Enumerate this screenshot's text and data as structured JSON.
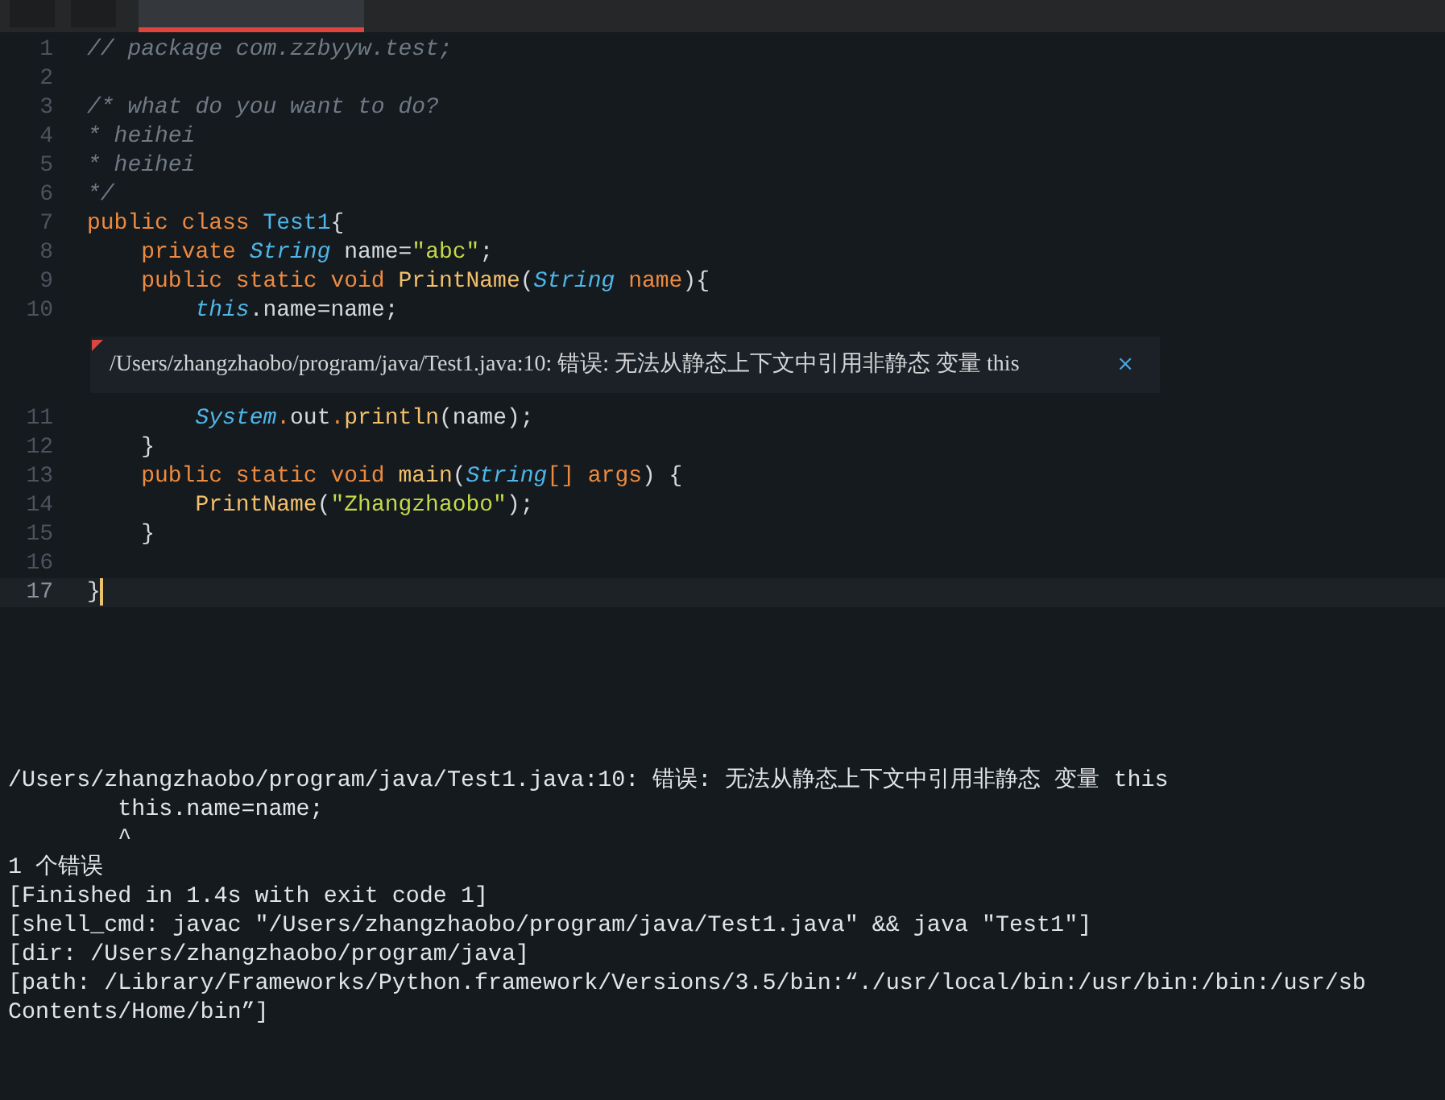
{
  "tab_bar": {
    "tabs": [
      {
        "selected": true
      }
    ]
  },
  "editor": {
    "lines": [
      {
        "number": "1",
        "current": false,
        "tokens": [
          {
            "kind": "comment",
            "text": "// package com.zzbyyw.test;"
          }
        ]
      },
      {
        "number": "2",
        "current": false
      },
      {
        "number": "3",
        "current": false,
        "tokens": [
          {
            "kind": "comment",
            "text": "/* what do you want to do?"
          }
        ]
      },
      {
        "number": "4",
        "current": false,
        "tokens": [
          {
            "kind": "comment",
            "text": "* heihei"
          }
        ]
      },
      {
        "number": "5",
        "current": false,
        "tokens": [
          {
            "kind": "comment",
            "text": "* heihei"
          }
        ]
      },
      {
        "number": "6",
        "current": false,
        "tokens": [
          {
            "kind": "comment",
            "text": "*/"
          }
        ]
      },
      {
        "number": "7",
        "current": false,
        "tokens": [
          {
            "kind": "keyword",
            "text": "public class "
          },
          {
            "kind": "classname",
            "text": "Test1"
          },
          {
            "kind": "plain",
            "text": "{"
          }
        ]
      },
      {
        "number": "8",
        "current": false,
        "tokens": [
          {
            "kind": "keyword",
            "text": "    private "
          },
          {
            "kind": "type",
            "text": "String"
          },
          {
            "kind": "plain",
            "text": " name="
          },
          {
            "kind": "string",
            "text": "\"abc\""
          },
          {
            "kind": "plain",
            "text": ";"
          }
        ]
      },
      {
        "number": "9",
        "current": false,
        "tokens": [
          {
            "kind": "keyword",
            "text": "    public static void "
          },
          {
            "kind": "func",
            "text": "PrintName"
          },
          {
            "kind": "plain",
            "text": "("
          },
          {
            "kind": "type",
            "text": "String"
          },
          {
            "kind": "param",
            "text": " name"
          },
          {
            "kind": "plain",
            "text": "){"
          }
        ]
      },
      {
        "number": "10",
        "current": false,
        "tokens": [
          {
            "kind": "type",
            "text": "        this"
          },
          {
            "kind": "plain",
            "text": ".name=name;"
          }
        ],
        "error": {
          "message": "/Users/zhangzhaobo/program/java/Test1.java:10: 错误: 无法从静态上下文中引用非静态 变量 this",
          "close": "×"
        }
      },
      {
        "number": "11",
        "current": false,
        "tokens": [
          {
            "kind": "type",
            "text": "        System"
          },
          {
            "kind": "keyword",
            "text": "."
          },
          {
            "kind": "plain",
            "text": "out"
          },
          {
            "kind": "keyword",
            "text": "."
          },
          {
            "kind": "func",
            "text": "println"
          },
          {
            "kind": "plain",
            "text": "(name);"
          }
        ]
      },
      {
        "number": "12",
        "current": false,
        "tokens": [
          {
            "kind": "plain",
            "text": "    }"
          }
        ]
      },
      {
        "number": "13",
        "current": false,
        "tokens": [
          {
            "kind": "keyword",
            "text": "    public static void "
          },
          {
            "kind": "func",
            "text": "main"
          },
          {
            "kind": "plain",
            "text": "("
          },
          {
            "kind": "type",
            "text": "String"
          },
          {
            "kind": "keyword",
            "text": "[]"
          },
          {
            "kind": "param",
            "text": " args"
          },
          {
            "kind": "plain",
            "text": ") {"
          }
        ]
      },
      {
        "number": "14",
        "current": false,
        "tokens": [
          {
            "kind": "func",
            "text": "        PrintName"
          },
          {
            "kind": "plain",
            "text": "("
          },
          {
            "kind": "string",
            "text": "\"Zhangzhaobo\""
          },
          {
            "kind": "plain",
            "text": ");"
          }
        ]
      },
      {
        "number": "15",
        "current": false,
        "tokens": [
          {
            "kind": "plain",
            "text": "    }"
          }
        ]
      },
      {
        "number": "16",
        "current": false
      },
      {
        "number": "17",
        "current": true,
        "tokens": [
          {
            "kind": "plain",
            "text": "}"
          }
        ]
      }
    ]
  },
  "build_output": {
    "lines": [
      "/Users/zhangzhaobo/program/java/Test1.java:10: 错误: 无法从静态上下文中引用非静态 变量 this",
      "        this.name=name;",
      "        ^",
      "1 个错误",
      "[Finished in 1.4s with exit code 1]",
      "[shell_cmd: javac \"/Users/zhangzhaobo/program/java/Test1.java\" && java \"Test1\"]",
      "[dir: /Users/zhangzhaobo/program/java]",
      "[path: /Library/Frameworks/Python.framework/Versions/3.5/bin:“./usr/local/bin:/usr/bin:/bin:/usr/sb",
      "Contents/Home/bin”]"
    ]
  }
}
